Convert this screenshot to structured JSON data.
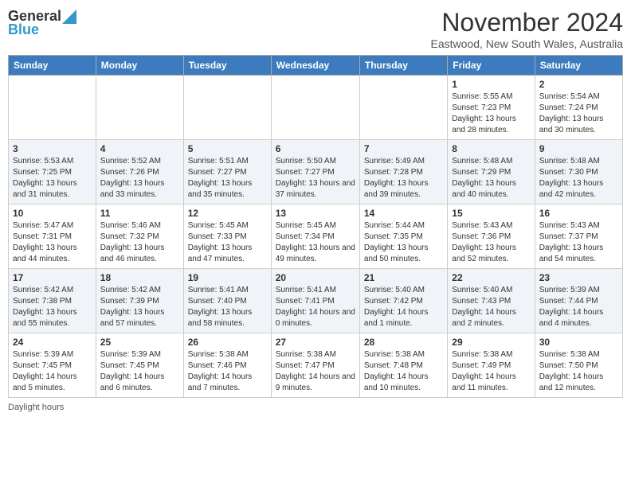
{
  "header": {
    "logo_general": "General",
    "logo_blue": "Blue",
    "title": "November 2024",
    "subtitle": "Eastwood, New South Wales, Australia"
  },
  "days_of_week": [
    "Sunday",
    "Monday",
    "Tuesday",
    "Wednesday",
    "Thursday",
    "Friday",
    "Saturday"
  ],
  "weeks": [
    [
      {
        "day": "",
        "info": ""
      },
      {
        "day": "",
        "info": ""
      },
      {
        "day": "",
        "info": ""
      },
      {
        "day": "",
        "info": ""
      },
      {
        "day": "",
        "info": ""
      },
      {
        "day": "1",
        "info": "Sunrise: 5:55 AM\nSunset: 7:23 PM\nDaylight: 13 hours and 28 minutes."
      },
      {
        "day": "2",
        "info": "Sunrise: 5:54 AM\nSunset: 7:24 PM\nDaylight: 13 hours and 30 minutes."
      }
    ],
    [
      {
        "day": "3",
        "info": "Sunrise: 5:53 AM\nSunset: 7:25 PM\nDaylight: 13 hours and 31 minutes."
      },
      {
        "day": "4",
        "info": "Sunrise: 5:52 AM\nSunset: 7:26 PM\nDaylight: 13 hours and 33 minutes."
      },
      {
        "day": "5",
        "info": "Sunrise: 5:51 AM\nSunset: 7:27 PM\nDaylight: 13 hours and 35 minutes."
      },
      {
        "day": "6",
        "info": "Sunrise: 5:50 AM\nSunset: 7:27 PM\nDaylight: 13 hours and 37 minutes."
      },
      {
        "day": "7",
        "info": "Sunrise: 5:49 AM\nSunset: 7:28 PM\nDaylight: 13 hours and 39 minutes."
      },
      {
        "day": "8",
        "info": "Sunrise: 5:48 AM\nSunset: 7:29 PM\nDaylight: 13 hours and 40 minutes."
      },
      {
        "day": "9",
        "info": "Sunrise: 5:48 AM\nSunset: 7:30 PM\nDaylight: 13 hours and 42 minutes."
      }
    ],
    [
      {
        "day": "10",
        "info": "Sunrise: 5:47 AM\nSunset: 7:31 PM\nDaylight: 13 hours and 44 minutes."
      },
      {
        "day": "11",
        "info": "Sunrise: 5:46 AM\nSunset: 7:32 PM\nDaylight: 13 hours and 46 minutes."
      },
      {
        "day": "12",
        "info": "Sunrise: 5:45 AM\nSunset: 7:33 PM\nDaylight: 13 hours and 47 minutes."
      },
      {
        "day": "13",
        "info": "Sunrise: 5:45 AM\nSunset: 7:34 PM\nDaylight: 13 hours and 49 minutes."
      },
      {
        "day": "14",
        "info": "Sunrise: 5:44 AM\nSunset: 7:35 PM\nDaylight: 13 hours and 50 minutes."
      },
      {
        "day": "15",
        "info": "Sunrise: 5:43 AM\nSunset: 7:36 PM\nDaylight: 13 hours and 52 minutes."
      },
      {
        "day": "16",
        "info": "Sunrise: 5:43 AM\nSunset: 7:37 PM\nDaylight: 13 hours and 54 minutes."
      }
    ],
    [
      {
        "day": "17",
        "info": "Sunrise: 5:42 AM\nSunset: 7:38 PM\nDaylight: 13 hours and 55 minutes."
      },
      {
        "day": "18",
        "info": "Sunrise: 5:42 AM\nSunset: 7:39 PM\nDaylight: 13 hours and 57 minutes."
      },
      {
        "day": "19",
        "info": "Sunrise: 5:41 AM\nSunset: 7:40 PM\nDaylight: 13 hours and 58 minutes."
      },
      {
        "day": "20",
        "info": "Sunrise: 5:41 AM\nSunset: 7:41 PM\nDaylight: 14 hours and 0 minutes."
      },
      {
        "day": "21",
        "info": "Sunrise: 5:40 AM\nSunset: 7:42 PM\nDaylight: 14 hours and 1 minute."
      },
      {
        "day": "22",
        "info": "Sunrise: 5:40 AM\nSunset: 7:43 PM\nDaylight: 14 hours and 2 minutes."
      },
      {
        "day": "23",
        "info": "Sunrise: 5:39 AM\nSunset: 7:44 PM\nDaylight: 14 hours and 4 minutes."
      }
    ],
    [
      {
        "day": "24",
        "info": "Sunrise: 5:39 AM\nSunset: 7:45 PM\nDaylight: 14 hours and 5 minutes."
      },
      {
        "day": "25",
        "info": "Sunrise: 5:39 AM\nSunset: 7:45 PM\nDaylight: 14 hours and 6 minutes."
      },
      {
        "day": "26",
        "info": "Sunrise: 5:38 AM\nSunset: 7:46 PM\nDaylight: 14 hours and 7 minutes."
      },
      {
        "day": "27",
        "info": "Sunrise: 5:38 AM\nSunset: 7:47 PM\nDaylight: 14 hours and 9 minutes."
      },
      {
        "day": "28",
        "info": "Sunrise: 5:38 AM\nSunset: 7:48 PM\nDaylight: 14 hours and 10 minutes."
      },
      {
        "day": "29",
        "info": "Sunrise: 5:38 AM\nSunset: 7:49 PM\nDaylight: 14 hours and 11 minutes."
      },
      {
        "day": "30",
        "info": "Sunrise: 5:38 AM\nSunset: 7:50 PM\nDaylight: 14 hours and 12 minutes."
      }
    ]
  ],
  "footer": {
    "daylight_label": "Daylight hours"
  }
}
